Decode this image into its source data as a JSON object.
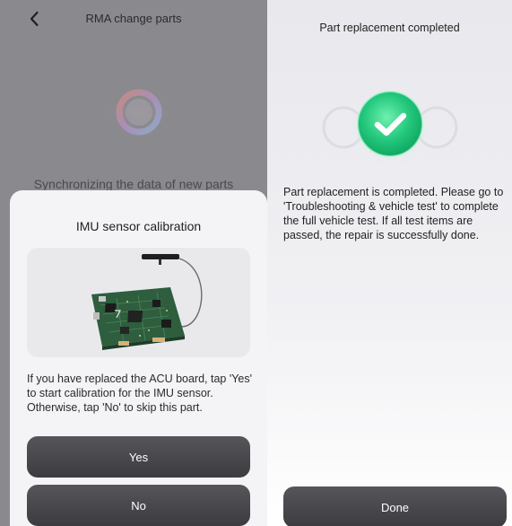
{
  "left": {
    "header": {
      "title": "RMA change parts",
      "back_icon": "chevron-left-icon"
    },
    "sync_status": "Synchronizing the data of new parts",
    "sheet": {
      "title": "IMU sensor calibration",
      "image": "acu-board-illustration",
      "description": "If you have replaced the ACU board, tap 'Yes' to start calibration for the IMU sensor. Otherwise, tap 'No' to skip this part.",
      "yes_label": "Yes",
      "no_label": "No"
    }
  },
  "right": {
    "title": "Part replacement completed",
    "icon": "check-icon",
    "description": "Part replacement is completed. Please go to 'Troubleshooting & vehicle test' to complete the full vehicle test. If all test items are passed, the repair is successfully done.",
    "done_label": "Done"
  },
  "colors": {
    "overlay": "#8a8a8e",
    "sheet_bg": "#f4f4f6",
    "button_dark": "#45454a",
    "success_green": "#2bcf86"
  }
}
